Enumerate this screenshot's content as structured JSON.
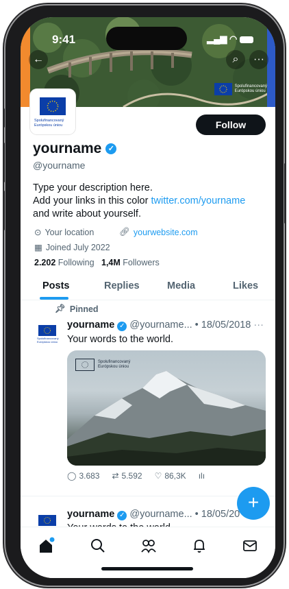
{
  "status": {
    "time": "9:41"
  },
  "profile": {
    "name": "yourname",
    "handle": "@yourname",
    "bio_line1": "Type your description here.",
    "bio_line2_prefix": "Add your links in this color ",
    "bio_link": "twitter.com/yourname",
    "bio_line3": "and write about yourself.",
    "location": "Your location",
    "website": "yourwebsite.com",
    "joined": "Joined July 2022",
    "following_count": "2.202",
    "following_label": "Following",
    "followers_count": "1,4M",
    "followers_label": "Followers",
    "follow_button": "Follow"
  },
  "eu_label": {
    "line1": "Spolufinancovaný",
    "line2": "Európskou úniou"
  },
  "tabs": [
    {
      "label": "Posts"
    },
    {
      "label": "Replies"
    },
    {
      "label": "Media"
    },
    {
      "label": "Likes"
    }
  ],
  "posts": [
    {
      "pinned_label": "Pinned",
      "name": "yourname",
      "handle_date": "@yourname... • 18/05/2018",
      "more": "···",
      "text": "Your words to the world.",
      "replies": "3.683",
      "retweets": "5.592",
      "likes": "86,3K"
    },
    {
      "name": "yourname",
      "handle_date": "@yourname... • 18/05/20",
      "text": "Your words to the world"
    }
  ],
  "fab_label": "+",
  "colors": {
    "accent": "#1d9bf0",
    "eu_blue": "#0b3ea8",
    "banner_orange": "#f28a2e",
    "banner_blue": "#2d5ac8"
  },
  "nav_icons": [
    "home-icon",
    "search-icon",
    "communities-icon",
    "notifications-icon",
    "messages-icon"
  ]
}
